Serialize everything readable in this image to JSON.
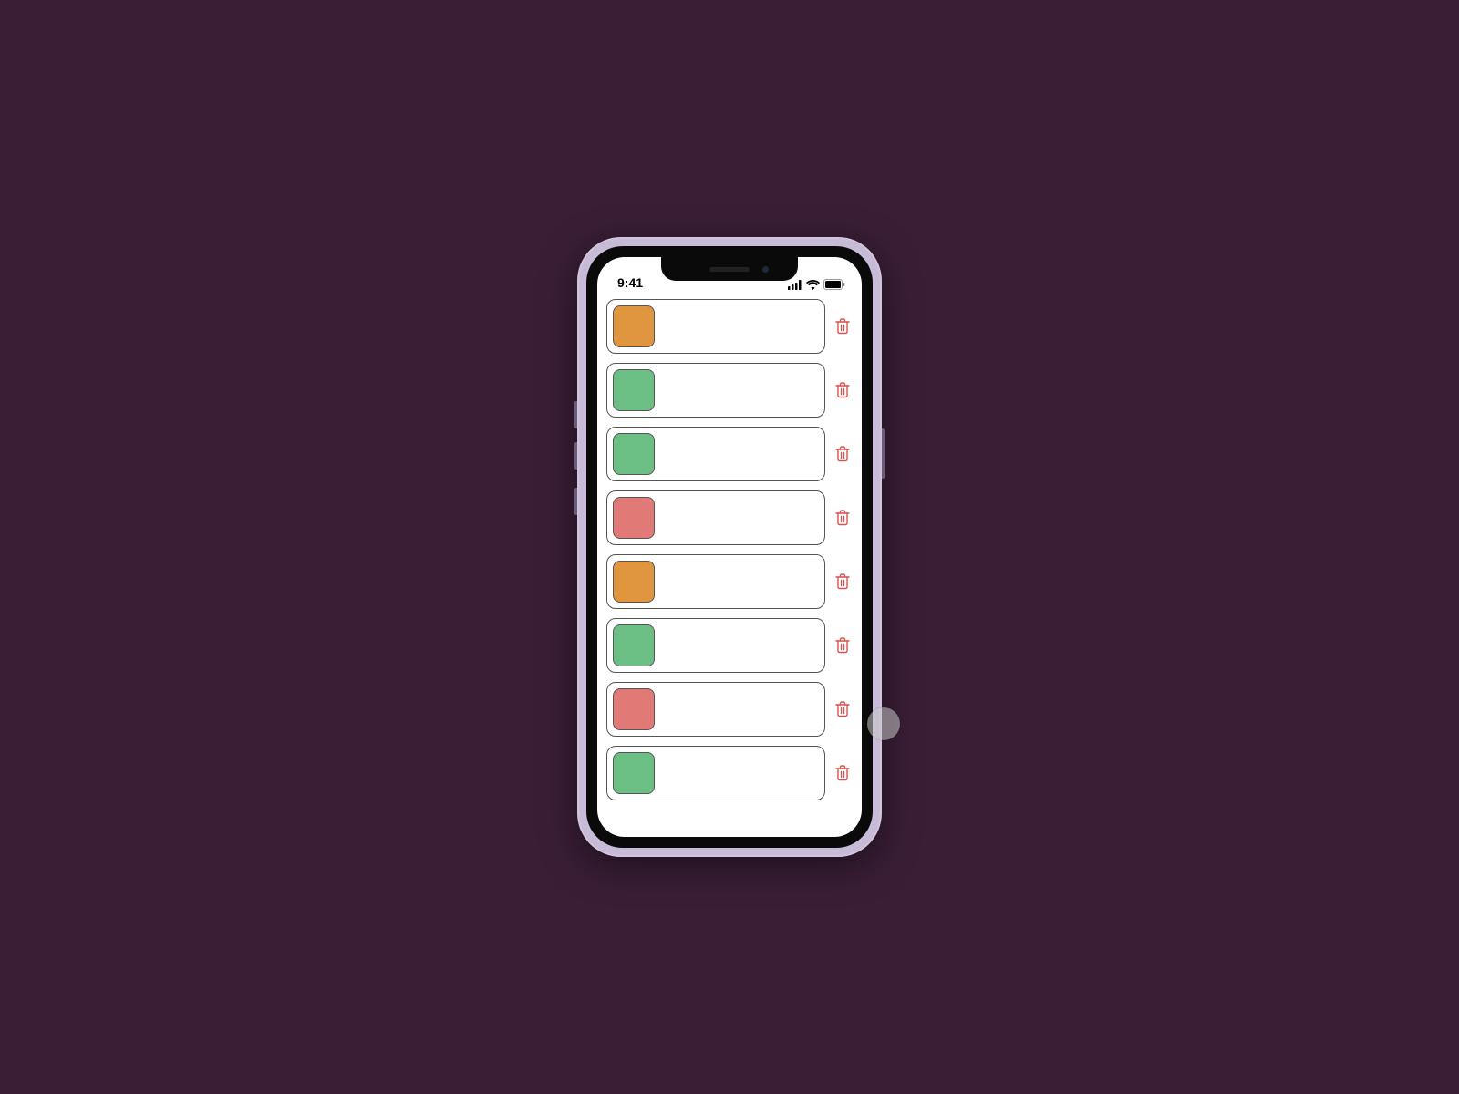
{
  "status": {
    "time": "9:41"
  },
  "colors": {
    "orange": "#e0953f",
    "green": "#6cbf84",
    "red": "#e17a76",
    "trash": "#d9534f",
    "border": "#555555"
  },
  "items": [
    {
      "color": "orange"
    },
    {
      "color": "green"
    },
    {
      "color": "green"
    },
    {
      "color": "red"
    },
    {
      "color": "orange"
    },
    {
      "color": "green"
    },
    {
      "color": "red"
    },
    {
      "color": "green"
    }
  ]
}
